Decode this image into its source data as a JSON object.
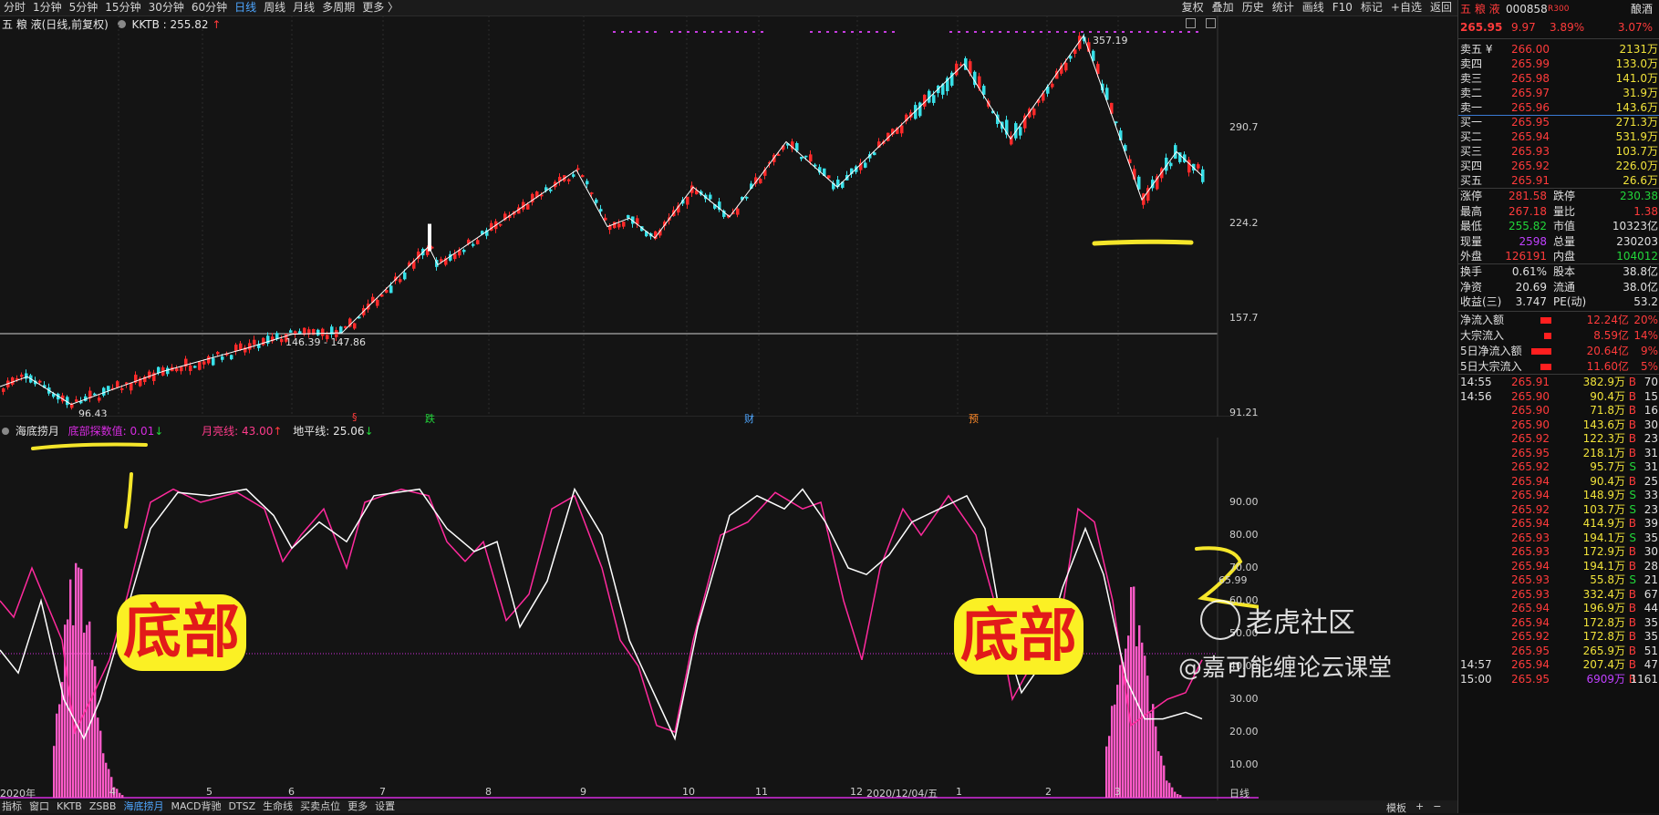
{
  "toolbar": {
    "periods": [
      "分时",
      "1分钟",
      "5分钟",
      "15分钟",
      "30分钟",
      "60分钟",
      "日线",
      "周线",
      "月线",
      "多周期",
      "更多 〉"
    ],
    "active_period": "日线",
    "tools": [
      "复权",
      "叠加",
      "历史",
      "统计",
      "画线",
      "F10",
      "标记",
      "+自选",
      "返回"
    ]
  },
  "header": {
    "title": "五 粮 液(日线,前复权)",
    "indicator": "KKTB : 255.82",
    "indicator_arrow": "↑"
  },
  "price_axis": [
    "290.7",
    "224.2",
    "157.7",
    "91.21"
  ],
  "annotations": {
    "high": "357.19",
    "low": "96.43",
    "range": "146.39 - 147.86"
  },
  "event_marks": [
    "§",
    "跌",
    "财",
    "预"
  ],
  "indicator_panel": {
    "name": "海底捞月",
    "bottom_label": "底部探数值: 0.01",
    "bottom_arrow": "↓",
    "moon_label": "月亮线: 43.00",
    "moon_arrow": "↑",
    "horizon_label": "地平线: 25.06",
    "horizon_arrow": "↓",
    "axis": [
      "90.00",
      "80.00",
      "70.00",
      "65.99",
      "60.00",
      "50.00",
      "40.00",
      "30.00",
      "20.00",
      "10.00"
    ]
  },
  "time_axis": [
    "2020年",
    "4",
    "5",
    "6",
    "7",
    "8",
    "9",
    "10",
    "11",
    "12",
    "2020/12/04/五",
    "1",
    "2",
    "3",
    "日线"
  ],
  "bottom_tabs": [
    "指标",
    "窗口",
    "KKTB",
    "ZSBB",
    "海底捞月",
    "MACD背驰",
    "DTSZ",
    "生命线",
    "买卖点位",
    "更多",
    "设置"
  ],
  "active_bottom_tab": "海底捞月",
  "bottom_right": [
    "模板",
    "+",
    "−"
  ],
  "overlay_text": {
    "left_bubble": "底部",
    "right_bubble": "底部",
    "watermark1": "老虎社区",
    "watermark2": "@嘉可能缠论云课堂"
  },
  "quote": {
    "name": "五 粮 液",
    "code": "000858",
    "badge": "R300",
    "sector": "酿酒",
    "price": "265.95",
    "change": "9.97",
    "pct": "3.89%",
    "extra_pct": "3.07%",
    "asks": [
      {
        "label": "卖五 ¥",
        "price": "266.00",
        "vol": "2131万"
      },
      {
        "label": "卖四",
        "price": "265.99",
        "vol": "133.0万"
      },
      {
        "label": "卖三",
        "price": "265.98",
        "vol": "141.0万"
      },
      {
        "label": "卖二",
        "price": "265.97",
        "vol": "31.9万"
      },
      {
        "label": "卖一",
        "price": "265.96",
        "vol": "143.6万"
      }
    ],
    "bids": [
      {
        "label": "买一",
        "price": "265.95",
        "vol": "271.3万"
      },
      {
        "label": "买二",
        "price": "265.94",
        "vol": "531.9万"
      },
      {
        "label": "买三",
        "price": "265.93",
        "vol": "103.7万"
      },
      {
        "label": "买四",
        "price": "265.92",
        "vol": "226.0万"
      },
      {
        "label": "买五",
        "price": "265.91",
        "vol": "26.6万"
      }
    ],
    "stats": [
      {
        "l1": "涨停",
        "v1": "281.58",
        "c1": "red",
        "l2": "跌停",
        "v2": "230.38",
        "c2": "green"
      },
      {
        "l1": "最高",
        "v1": "267.18",
        "c1": "red",
        "l2": "量比",
        "v2": "1.38",
        "c2": "red"
      },
      {
        "l1": "最低",
        "v1": "255.82",
        "c1": "green",
        "l2": "市值",
        "v2": "10323亿",
        "c2": "white"
      },
      {
        "l1": "现量",
        "v1": "2598",
        "c1": "purple",
        "l2": "总量",
        "v2": "230203",
        "c2": "white"
      },
      {
        "l1": "外盘",
        "v1": "126191",
        "c1": "red",
        "l2": "内盘",
        "v2": "104012",
        "c2": "green"
      }
    ],
    "stats2": [
      {
        "l1": "换手",
        "v1": "0.61%",
        "l2": "股本",
        "v2": "38.8亿"
      },
      {
        "l1": "净资",
        "v1": "20.69",
        "l2": "流通",
        "v2": "38.0亿"
      },
      {
        "l1": "收益(三)",
        "v1": "3.747",
        "l2": "PE(动)",
        "v2": "53.2"
      }
    ],
    "flows": [
      {
        "label": "净流入额",
        "val": "12.24亿",
        "pct": "20%",
        "bar": 12
      },
      {
        "label": "大宗流入",
        "val": "8.59亿",
        "pct": "14%",
        "bar": 8
      },
      {
        "label": "5日净流入额",
        "val": "20.64亿",
        "pct": "9%",
        "bar": 22
      },
      {
        "label": "5日大宗流入",
        "val": "11.60亿",
        "pct": "5%",
        "bar": 12
      }
    ],
    "ticks": [
      {
        "t": "14:55",
        "p": "265.91",
        "v": "382.9万",
        "s": "B",
        "n": "70"
      },
      {
        "t": "14:56",
        "p": "265.90",
        "v": "90.4万",
        "s": "B",
        "n": "15"
      },
      {
        "t": "",
        "p": "265.90",
        "v": "71.8万",
        "s": "B",
        "n": "16"
      },
      {
        "t": "",
        "p": "265.90",
        "v": "143.6万",
        "s": "B",
        "n": "30"
      },
      {
        "t": "",
        "p": "265.92",
        "v": "122.3万",
        "s": "B",
        "n": "23"
      },
      {
        "t": "",
        "p": "265.95",
        "v": "218.1万",
        "s": "B",
        "n": "31"
      },
      {
        "t": "",
        "p": "265.92",
        "v": "95.7万",
        "s": "S",
        "n": "31"
      },
      {
        "t": "",
        "p": "265.94",
        "v": "90.4万",
        "s": "B",
        "n": "25"
      },
      {
        "t": "",
        "p": "265.94",
        "v": "148.9万",
        "s": "S",
        "n": "33"
      },
      {
        "t": "",
        "p": "265.92",
        "v": "103.7万",
        "s": "S",
        "n": "23"
      },
      {
        "t": "",
        "p": "265.94",
        "v": "414.9万",
        "s": "B",
        "n": "39"
      },
      {
        "t": "",
        "p": "265.93",
        "v": "194.1万",
        "s": "S",
        "n": "35"
      },
      {
        "t": "",
        "p": "265.93",
        "v": "172.9万",
        "s": "B",
        "n": "30"
      },
      {
        "t": "",
        "p": "265.94",
        "v": "194.1万",
        "s": "B",
        "n": "28"
      },
      {
        "t": "",
        "p": "265.93",
        "v": "55.8万",
        "s": "S",
        "n": "21"
      },
      {
        "t": "",
        "p": "265.93",
        "v": "332.4万",
        "s": "B",
        "n": "67"
      },
      {
        "t": "",
        "p": "265.94",
        "v": "196.9万",
        "s": "B",
        "n": "44"
      },
      {
        "t": "",
        "p": "265.94",
        "v": "172.8万",
        "s": "B",
        "n": "35"
      },
      {
        "t": "",
        "p": "265.92",
        "v": "172.8万",
        "s": "B",
        "n": "35"
      },
      {
        "t": "",
        "p": "265.95",
        "v": "265.9万",
        "s": "B",
        "n": "51"
      },
      {
        "t": "14:57",
        "p": "265.94",
        "v": "207.4万",
        "s": "B",
        "n": "47"
      },
      {
        "t": "15:00",
        "p": "265.95",
        "v": "6909万",
        "s": "B",
        "n": "1161"
      }
    ]
  },
  "colors": {
    "up": "#ff2a2a",
    "down": "#38e0e8",
    "ind_pink": "#ff2a9d",
    "ind_white": "#ffffff",
    "bubble": "#fbf024"
  }
}
